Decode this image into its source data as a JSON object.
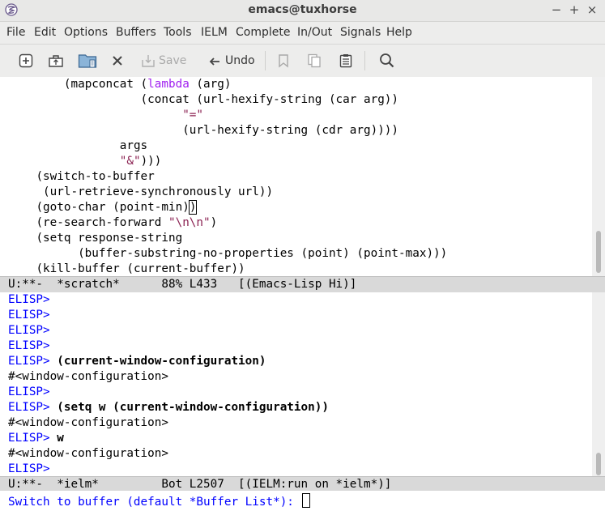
{
  "window": {
    "title": "emacs@tuxhorse",
    "controls": {
      "minimize": "−",
      "maximize": "+",
      "close": "×"
    }
  },
  "menubar": [
    "File",
    "Edit",
    "Options",
    "Buffers",
    "Tools",
    "IELM",
    "Complete",
    "In/Out",
    "Signals",
    "Help"
  ],
  "toolbar": {
    "save_label": "Save",
    "undo_label": "Undo"
  },
  "scratch": {
    "lines": [
      {
        "indent": "        ",
        "parts": [
          {
            "t": "(mapconcat (",
            "c": ""
          },
          {
            "t": "lambda",
            "c": "kw"
          },
          {
            "t": " (arg)",
            "c": ""
          }
        ]
      },
      {
        "indent": "                   ",
        "parts": [
          {
            "t": "(concat (url-hexify-string (car arg))",
            "c": ""
          }
        ]
      },
      {
        "indent": "                         ",
        "parts": [
          {
            "t": "\"=\"",
            "c": "str"
          }
        ]
      },
      {
        "indent": "                         ",
        "parts": [
          {
            "t": "(url-hexify-string (cdr arg))))",
            "c": ""
          }
        ]
      },
      {
        "indent": "                ",
        "parts": [
          {
            "t": "args",
            "c": ""
          }
        ]
      },
      {
        "indent": "                ",
        "parts": [
          {
            "t": "\"&\"",
            "c": "str"
          },
          {
            "t": ")))",
            "c": ""
          }
        ]
      },
      {
        "indent": "    ",
        "parts": [
          {
            "t": "(switch-to-buffer",
            "c": ""
          }
        ]
      },
      {
        "indent": "     ",
        "parts": [
          {
            "t": "(url-retrieve-synchronously url))",
            "c": ""
          }
        ]
      },
      {
        "indent": "    ",
        "parts": [
          {
            "t": "(goto-char (point-min)",
            "c": ""
          },
          {
            "t": ")",
            "c": "cursor"
          }
        ]
      },
      {
        "indent": "    ",
        "parts": [
          {
            "t": "(re-search-forward ",
            "c": ""
          },
          {
            "t": "\"\\n\\n\"",
            "c": "str"
          },
          {
            "t": ")",
            "c": ""
          }
        ]
      },
      {
        "indent": "    ",
        "parts": [
          {
            "t": "(setq response-string",
            "c": ""
          }
        ]
      },
      {
        "indent": "          ",
        "parts": [
          {
            "t": "(buffer-substring-no-properties (point) (point-max)))",
            "c": ""
          }
        ]
      },
      {
        "indent": "    ",
        "parts": [
          {
            "t": "(kill-buffer (current-buffer))",
            "c": ""
          }
        ]
      }
    ],
    "modeline": "U:**-  *scratch*      88% L433   [(Emacs-Lisp Hi)]"
  },
  "ielm": {
    "lines": [
      {
        "prompt": "ELISP>",
        "input": ""
      },
      {
        "prompt": "ELISP>",
        "input": ""
      },
      {
        "prompt": "ELISP>",
        "input": ""
      },
      {
        "prompt": "ELISP>",
        "input": ""
      },
      {
        "prompt": "ELISP>",
        "input": "(current-window-configuration)"
      },
      {
        "output": "#<window-configuration>"
      },
      {
        "prompt": "ELISP>",
        "input": ""
      },
      {
        "prompt": "ELISP>",
        "input": "(setq w (current-window-configuration))"
      },
      {
        "output": "#<window-configuration>"
      },
      {
        "prompt": "ELISP>",
        "input": "w"
      },
      {
        "output": "#<window-configuration>"
      },
      {
        "prompt": "ELISP>",
        "input": ""
      }
    ],
    "modeline": "U:**-  *ielm*         Bot L2507  [(IELM:run on *ielm*)]"
  },
  "minibuffer": {
    "prompt": "Switch to buffer (default *Buffer List*): "
  }
}
